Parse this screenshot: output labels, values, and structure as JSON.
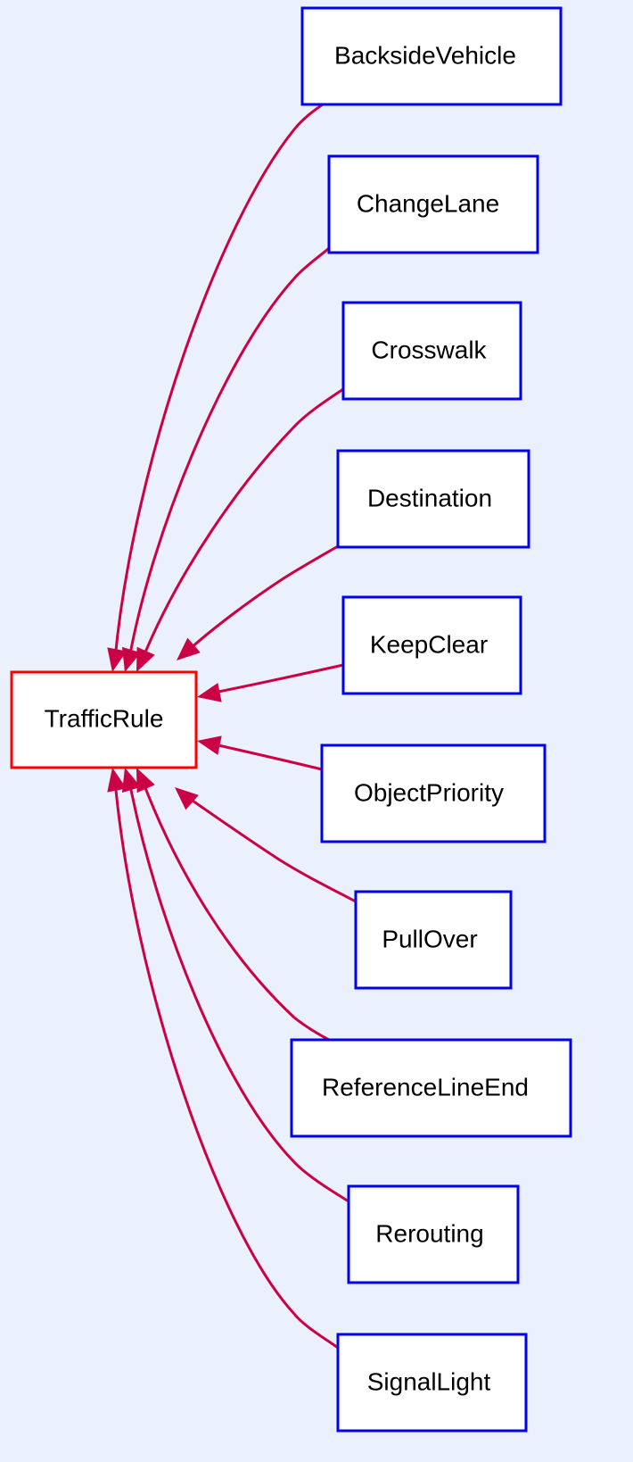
{
  "diagram": {
    "type": "class-inheritance",
    "colors": {
      "background": "#eaf0fc",
      "edge": "#cc0044",
      "node_border": "#0000ee",
      "root_border": "#ff0000",
      "node_fill": "#ffffff"
    },
    "root": {
      "id": "TrafficRule",
      "label": "TrafficRule"
    },
    "children": [
      {
        "id": "BacksideVehicle",
        "label": "BacksideVehicle"
      },
      {
        "id": "ChangeLane",
        "label": "ChangeLane"
      },
      {
        "id": "Crosswalk",
        "label": "Crosswalk"
      },
      {
        "id": "Destination",
        "label": "Destination"
      },
      {
        "id": "KeepClear",
        "label": "KeepClear"
      },
      {
        "id": "ObjectPriority",
        "label": "ObjectPriority"
      },
      {
        "id": "PullOver",
        "label": "PullOver"
      },
      {
        "id": "ReferenceLineEnd",
        "label": "ReferenceLineEnd"
      },
      {
        "id": "Rerouting",
        "label": "Rerouting"
      },
      {
        "id": "SignalLight",
        "label": "SignalLight"
      }
    ],
    "edges": [
      {
        "from": "BacksideVehicle",
        "to": "TrafficRule"
      },
      {
        "from": "ChangeLane",
        "to": "TrafficRule"
      },
      {
        "from": "Crosswalk",
        "to": "TrafficRule"
      },
      {
        "from": "Destination",
        "to": "TrafficRule"
      },
      {
        "from": "KeepClear",
        "to": "TrafficRule"
      },
      {
        "from": "ObjectPriority",
        "to": "TrafficRule"
      },
      {
        "from": "PullOver",
        "to": "TrafficRule"
      },
      {
        "from": "ReferenceLineEnd",
        "to": "TrafficRule"
      },
      {
        "from": "Rerouting",
        "to": "TrafficRule"
      },
      {
        "from": "SignalLight",
        "to": "TrafficRule"
      }
    ]
  }
}
